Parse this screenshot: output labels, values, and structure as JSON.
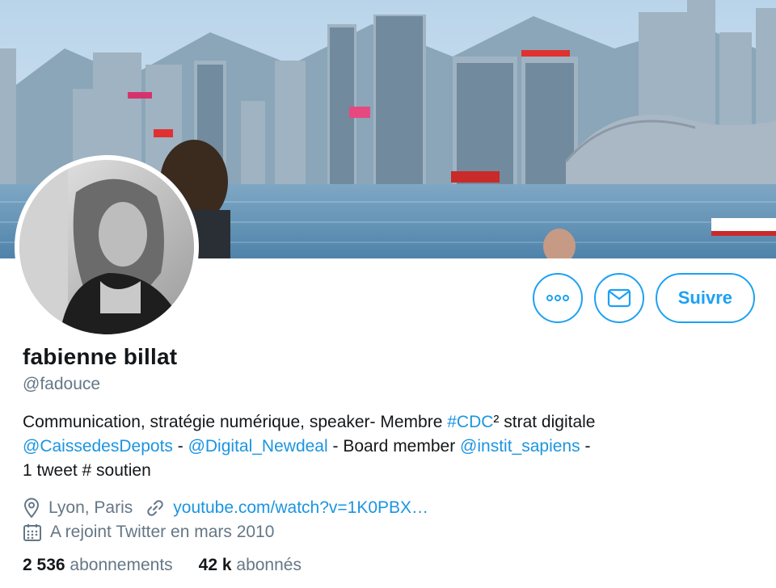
{
  "banner": {
    "description_icon": "banner-image"
  },
  "avatar": {
    "icon": "avatar-photo"
  },
  "actions": {
    "more_icon": "more-dots-icon",
    "message_icon": "envelope-icon",
    "follow_label": "Suivre",
    "accent": "#1da1f2"
  },
  "profile": {
    "name": "fabienne billat",
    "handle": "@fadouce"
  },
  "bio": {
    "line1_text": "Communication, stratégie numérique, speaker- Membre ",
    "line1_link": "#CDC",
    "line1_tail": "² strat digitale",
    "line2_link1": "@CaissedesDepots",
    "line2_sep1": " - ",
    "line2_link2": "@Digital_Newdeal",
    "line2_mid": " - Board member ",
    "line2_link3": "@instit_sapiens",
    "line2_tail": " -",
    "line3": "1 tweet # soutien"
  },
  "meta": {
    "location_icon": "location-pin-icon",
    "location": "Lyon, Paris",
    "link_icon": "link-icon",
    "url": "youtube.com/watch?v=1K0PBX…",
    "calendar_icon": "calendar-icon",
    "joined": "A rejoint Twitter en mars 2010"
  },
  "stats": {
    "following_count": "2 536",
    "following_label": "abonnements",
    "followers_count": "42 k",
    "followers_label": "abonnés"
  },
  "colors": {
    "link": "#1b95e0",
    "muted": "#657786",
    "text": "#14171a"
  }
}
